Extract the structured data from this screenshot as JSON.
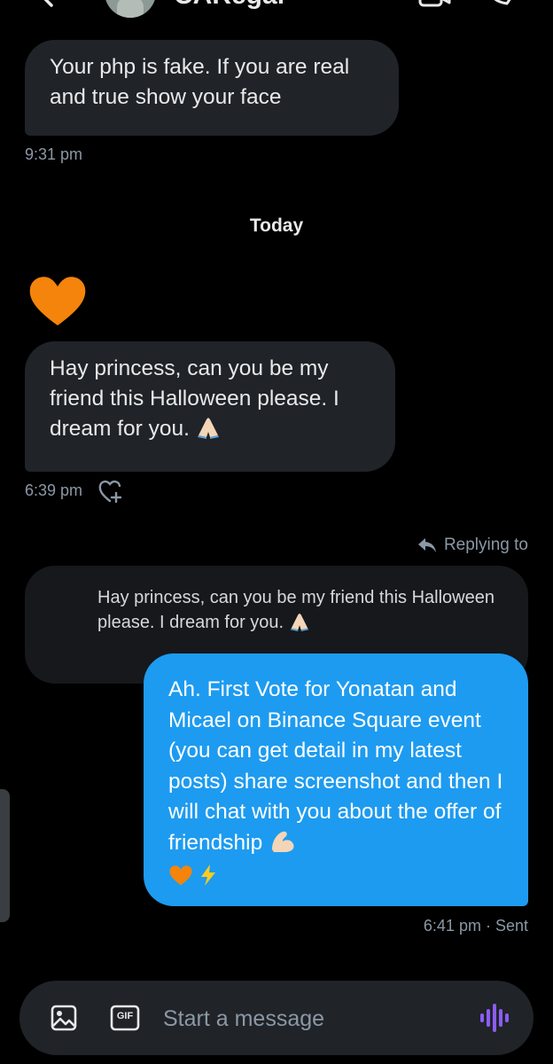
{
  "header": {
    "contact_name": "CARegar",
    "back_icon": "chevron-left-icon",
    "video_icon": "video-call-icon",
    "call_icon": "phone-call-icon"
  },
  "messages": {
    "msg1": {
      "text": "Your php is fake. If you are real and true show your face",
      "time": "9:31 pm"
    },
    "day_divider": "Today",
    "heart_emoji": "orange-heart-emoji",
    "msg2": {
      "text": "Hay princess, can you be my friend this Halloween please. I dream for you.",
      "time": "6:39 pm"
    },
    "reply": {
      "replying_label": "Replying to",
      "quoted_text": "Hay princess, can you be my friend this Halloween please. I dream for you.",
      "text": "Ah. First Vote for Yonatan and Micael on Binance Square event (you can get detail in my latest posts) share screenshot and then I will chat with you about the offer of friendship",
      "time": "6:41 pm",
      "status": "Sent"
    }
  },
  "composer": {
    "placeholder": "Start a message",
    "gif_label": "GIF",
    "image_icon": "image-icon",
    "voice_icon": "voice-message-icon"
  },
  "colors": {
    "background": "#000000",
    "incoming_bubble": "#202327",
    "outgoing_bubble": "#1d9bf0",
    "muted_text": "#8b98a5",
    "voice_accent": "#8b5cf6"
  }
}
